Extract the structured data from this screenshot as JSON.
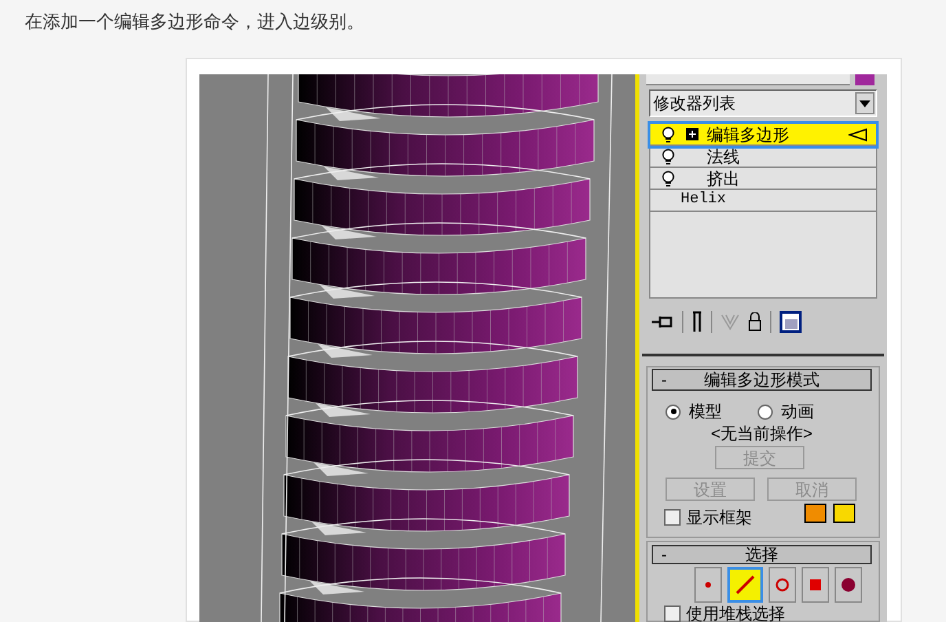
{
  "instruction": "在添加一个编辑多边形命令，进入边级别。",
  "modifier_panel": {
    "dropdown": "修改器列表",
    "stack": [
      {
        "label": "编辑多边形",
        "kind": "modifier",
        "selected": true,
        "expandable": true
      },
      {
        "label": "法线",
        "kind": "modifier",
        "selected": false,
        "expandable": false
      },
      {
        "label": "挤出",
        "kind": "modifier",
        "selected": false,
        "expandable": false
      },
      {
        "label": "Helix",
        "kind": "base",
        "selected": false,
        "expandable": false
      }
    ]
  },
  "edit_poly_mode": {
    "title": "编辑多边形模式",
    "collapse": "-",
    "modes": [
      {
        "label": "模型",
        "selected": true
      },
      {
        "label": "动画",
        "selected": false
      }
    ],
    "current_operation": "<无当前操作>",
    "commit": {
      "label": "提交",
      "disabled": true
    },
    "settings": {
      "label": "设置",
      "disabled": true
    },
    "cancel": {
      "label": "取消",
      "disabled": true
    },
    "show_cage": {
      "label": "显示框架",
      "checked": false
    },
    "cage_colors": [
      {
        "color": "#f08c00"
      },
      {
        "color": "#f8d800"
      }
    ]
  },
  "selection": {
    "title": "选择",
    "collapse": "-",
    "use_stack_selection": {
      "label": "使用堆栈选择",
      "checked": false
    }
  }
}
